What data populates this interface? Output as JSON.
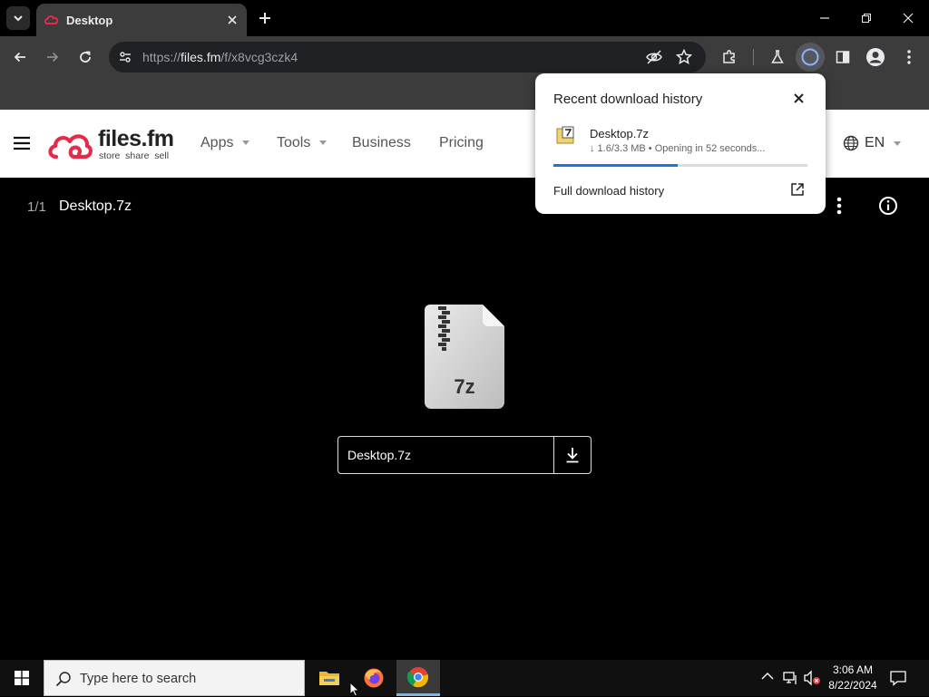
{
  "browser": {
    "tab_title": "Desktop",
    "url_prefix": "https://",
    "url_host": "files.fm",
    "url_path": "/f/x8vcg3czk4"
  },
  "site": {
    "logo_text": "files.fm",
    "logo_tagline": "store  share  sell",
    "nav": {
      "apps": "Apps",
      "tools": "Tools",
      "business": "Business",
      "pricing": "Pricing"
    },
    "language": "EN"
  },
  "viewer": {
    "counter": "1/1",
    "file_title": "Desktop.7z",
    "file_ext": "7z",
    "file_name": "Desktop.7z"
  },
  "download_popup": {
    "heading": "Recent download history",
    "file_name": "Desktop.7z",
    "status": "↓ 1.6/3.3 MB • Opening in 52 seconds...",
    "progress": 0.49,
    "full_history_label": "Full download history"
  },
  "taskbar": {
    "search_placeholder": "Type here to search",
    "time": "3:06 AM",
    "date": "8/22/2024"
  },
  "colors": {
    "brand": "#e52a4a",
    "progress": "#1a73e8",
    "browser_frame": "#3c3c3c"
  }
}
